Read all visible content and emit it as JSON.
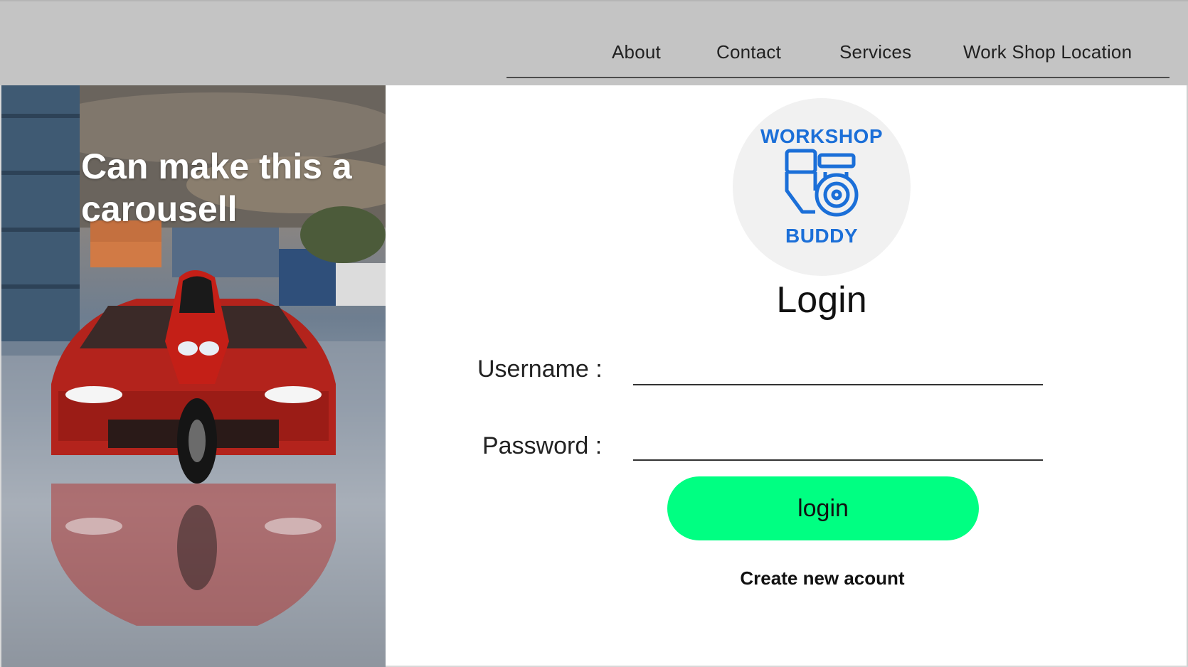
{
  "nav": {
    "about": "About",
    "contact": "Contact",
    "services": "Services",
    "location": "Work Shop Location"
  },
  "hero": {
    "caption": "Can make this a carousell"
  },
  "logo": {
    "top_text": "WORKSHOP",
    "bottom_text": "BUDDY",
    "color": "#1b6fd8"
  },
  "login": {
    "title": "Login",
    "username_label": "Username :",
    "username_value": "",
    "password_label": "Password :",
    "password_value": "",
    "button_label": "login",
    "button_color": "#00ff82",
    "create_account": "Create new acount"
  }
}
